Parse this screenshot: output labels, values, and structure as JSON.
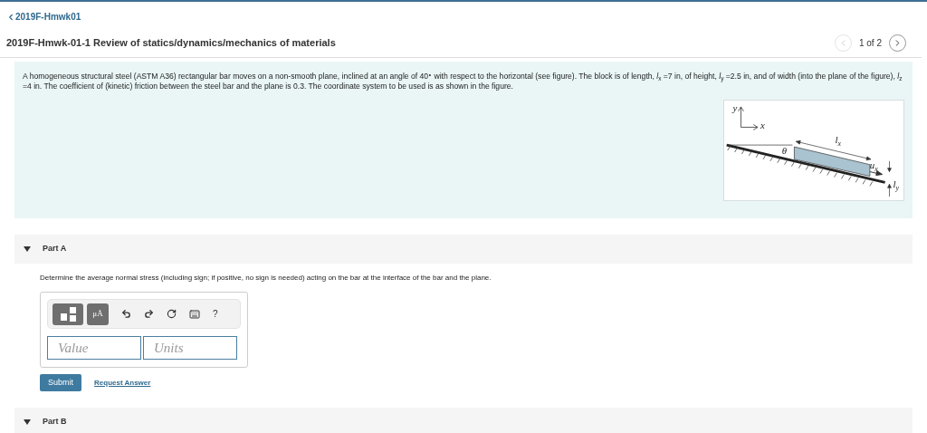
{
  "breadcrumb": {
    "label": "2019F-Hmwk01"
  },
  "title": "2019F-Hmwk-01-1 Review of statics/dynamics/mechanics of materials",
  "pager": {
    "text": "1 of 2",
    "prev_disabled": true,
    "next_disabled": false
  },
  "problem": {
    "text": "A homogeneous structural steel (ASTM A36) rectangular bar moves on a non-smooth plane, inclined at an angle of 40$^{∘}$ with respect to the horizontal (see figure).  The block is of length,  *l*$_{x}$ =7 in,  of height, *l*$_{y}$ =2.5 in, and of width (into the plane of the figure), *l*$_{z}$ =4 in.  The coefficient of (kinetic) friction between the steel bar and the plane is 0.3.  The coordinate system to be used is as shown in the figure.",
    "figure": {
      "labels": [
        {
          "kind": "y",
          "text": "y"
        },
        {
          "kind": "x",
          "text": "x"
        },
        {
          "kind": "theta",
          "text": "θ"
        },
        {
          "kind": "lx",
          "text": "l",
          "sub": "x"
        },
        {
          "kind": "ux",
          "text": "u",
          "sub": "x"
        },
        {
          "kind": "ly",
          "text": "l",
          "sub": "y"
        }
      ]
    }
  },
  "parts": [
    {
      "title": "Part A",
      "expanded": true,
      "prompt": "Determine the average normal stress (including sign; if positive, no sign is needed) acting on the bar at the interface of the bar and the plane.",
      "toolbar": {
        "help": "?",
        "units_symbol": "μÅ"
      },
      "fields": [
        {
          "placeholder": "Value"
        },
        {
          "placeholder": "Units"
        }
      ],
      "submit": "Submit",
      "request": "Request Answer"
    },
    {
      "title": "Part B",
      "expanded": true
    }
  ]
}
